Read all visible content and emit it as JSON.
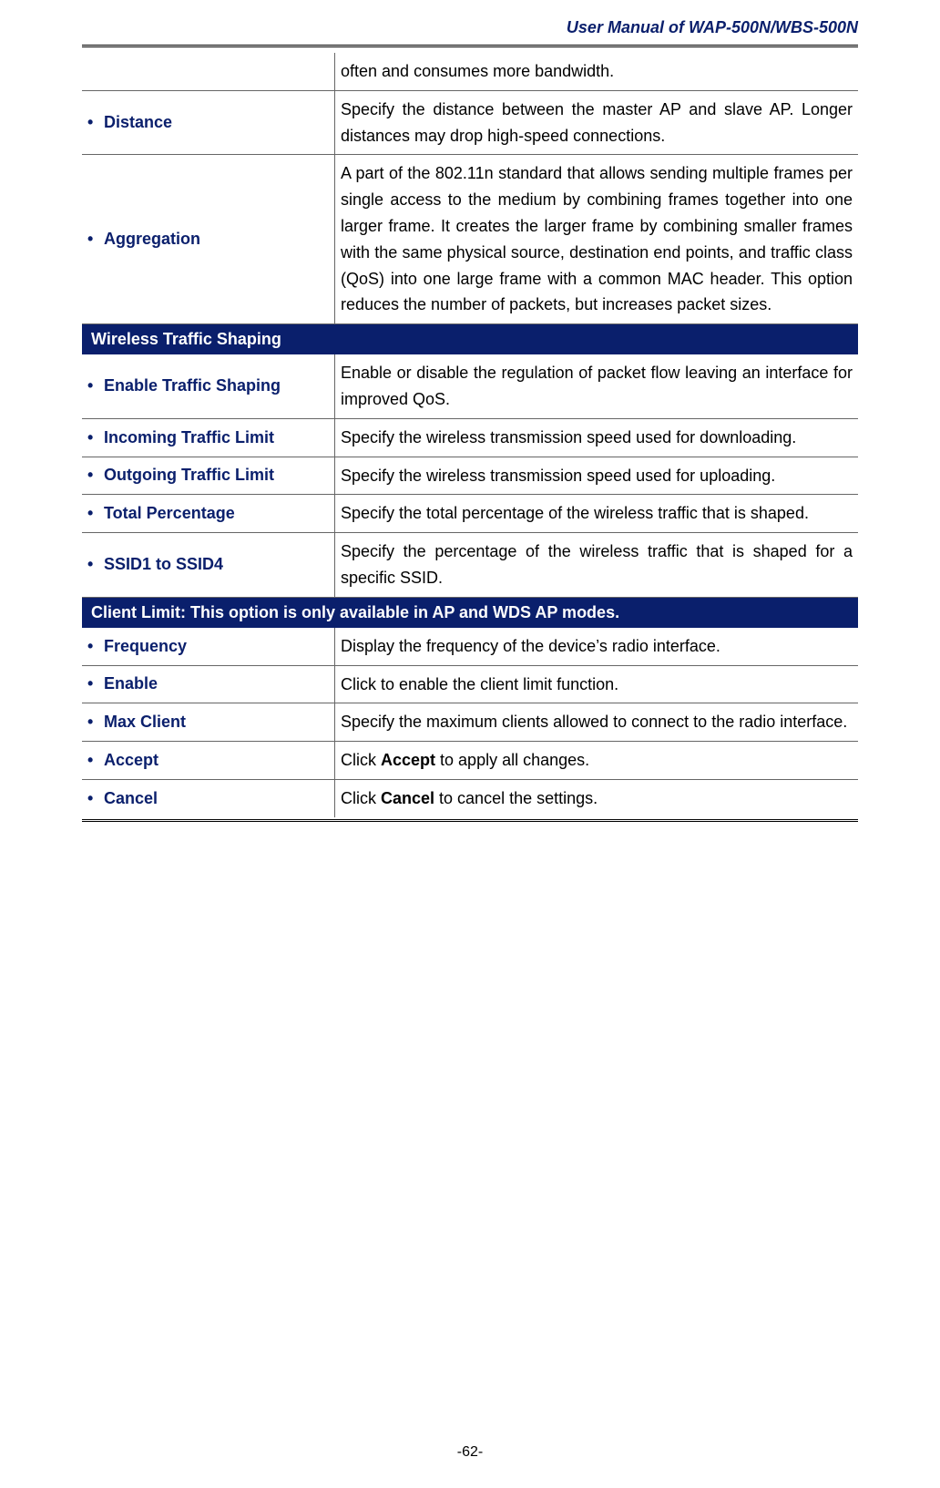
{
  "header": {
    "title": "User Manual of WAP-500N/WBS-500N"
  },
  "rows": [
    {
      "type": "row",
      "label": "",
      "desc": "often and consumes more bandwidth."
    },
    {
      "type": "row",
      "label": "Distance",
      "desc": "Specify the distance between the master AP and slave AP. Longer distances may drop high-speed connections."
    },
    {
      "type": "row",
      "label": "Aggregation",
      "desc": "A part of the 802.11n standard that allows sending multiple frames per single access to the medium by combining frames together into one larger frame. It creates the larger frame by combining smaller frames with the same physical source, destination end points, and traffic class (QoS) into one large frame with a common MAC header. This option reduces the number of packets, but increases packet sizes."
    },
    {
      "type": "section",
      "title": "Wireless Traffic Shaping"
    },
    {
      "type": "row",
      "label": "Enable Traffic Shaping",
      "desc": "Enable or disable the regulation of packet flow leaving an interface for improved QoS."
    },
    {
      "type": "row",
      "label": "Incoming Traffic Limit",
      "desc": "Specify the wireless transmission speed used for downloading."
    },
    {
      "type": "row",
      "label": "Outgoing Traffic Limit",
      "desc": "Specify the wireless transmission speed used for uploading."
    },
    {
      "type": "row",
      "label": "Total Percentage",
      "desc": "Specify the total percentage of the wireless traffic that is shaped."
    },
    {
      "type": "row",
      "label": "SSID1 to SSID4",
      "desc": "Specify the percentage of the wireless traffic that is shaped for a specific SSID."
    },
    {
      "type": "section",
      "title": "Client Limit: This option is only available in AP and WDS AP modes."
    },
    {
      "type": "row",
      "label": "Frequency",
      "desc": "Display the frequency of the device’s radio interface."
    },
    {
      "type": "row",
      "label": "Enable",
      "desc": "Click to enable the client limit function."
    },
    {
      "type": "row",
      "label": "Max Client",
      "desc": "Specify the maximum clients allowed to connect to the radio interface."
    },
    {
      "type": "row-strong",
      "label": "Accept",
      "pre": "Click ",
      "strong": "Accept",
      "post": " to apply all changes."
    },
    {
      "type": "row-strong",
      "label": "Cancel",
      "pre": "Click ",
      "strong": "Cancel",
      "post": " to cancel the settings.",
      "last": true
    }
  ],
  "pageNumber": "-62-"
}
